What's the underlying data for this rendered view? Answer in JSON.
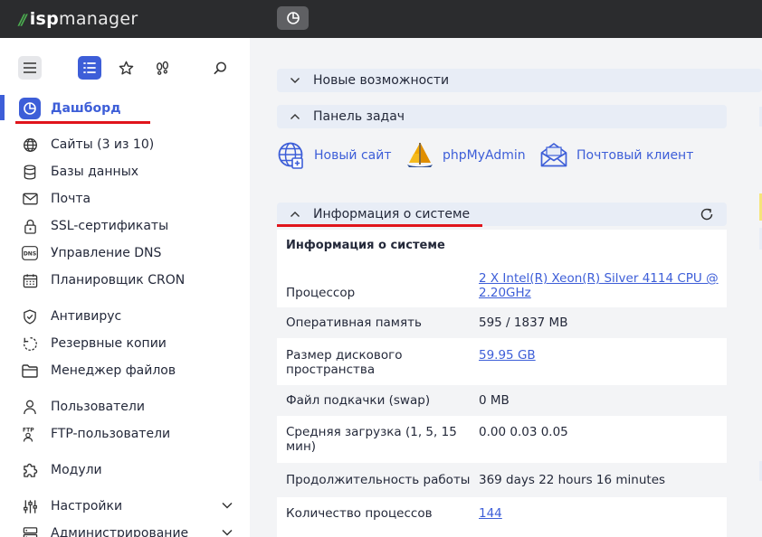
{
  "app": {
    "logo_text_a": "isp",
    "logo_text_b": "manager"
  },
  "sidebar": {
    "items": [
      {
        "label": "Дашборд",
        "icon": "dashboard-icon"
      },
      {
        "label": "Сайты (3 из 10)",
        "icon": "globe-icon"
      },
      {
        "label": "Базы данных",
        "icon": "database-icon"
      },
      {
        "label": "Почта",
        "icon": "mail-icon"
      },
      {
        "label": "SSL-сертификаты",
        "icon": "lock-icon"
      },
      {
        "label": "Управление DNS",
        "icon": "dns-icon"
      },
      {
        "label": "Планировщик CRON",
        "icon": "calendar-icon"
      },
      {
        "label": "Антивирус",
        "icon": "shield-icon"
      },
      {
        "label": "Резервные копии",
        "icon": "backup-icon"
      },
      {
        "label": "Менеджер файлов",
        "icon": "folder-icon"
      },
      {
        "label": "Пользователи",
        "icon": "user-icon"
      },
      {
        "label": "FTP-пользователи",
        "icon": "ftp-icon"
      },
      {
        "label": "Модули",
        "icon": "puzzle-icon"
      },
      {
        "label": "Настройки",
        "icon": "sliders-icon"
      },
      {
        "label": "Администрирование",
        "icon": "server-icon"
      }
    ]
  },
  "main": {
    "panels": {
      "news": "Новые возможности",
      "tasks": "Панель задач",
      "sysinfo": "Информация о системе"
    },
    "quick_actions": [
      {
        "label": "Новый сайт",
        "icon": "new-site-icon"
      },
      {
        "label": "phpMyAdmin",
        "icon": "phpmyadmin-icon"
      },
      {
        "label": "Почтовый клиент",
        "icon": "mail-client-icon"
      }
    ],
    "sysinfo": {
      "title": "Информация о системе",
      "rows": [
        {
          "label": "Процессор",
          "value": "2 X Intel(R) Xeon(R) Silver 4114 CPU @ 2.20GHz"
        },
        {
          "label": "Оперативная память",
          "value": "595 / 1837 MB"
        },
        {
          "label": "Размер дискового пространства",
          "value": "59.95 GB"
        },
        {
          "label": "Файл подкачки (swap)",
          "value": "0 MB"
        },
        {
          "label": "Средняя загрузка (1, 5, 15 мин)",
          "value": "0.00 0.03 0.05"
        },
        {
          "label": "Продолжительность работы",
          "value": "369 days 22 hours 16 minutes"
        },
        {
          "label": "Количество процессов",
          "value": "144"
        }
      ]
    }
  },
  "colors": {
    "accent": "#3d5ed8",
    "topbar": "#2b2c2e",
    "highlight_red": "#e0141b",
    "logo_green": "#4caf50"
  }
}
